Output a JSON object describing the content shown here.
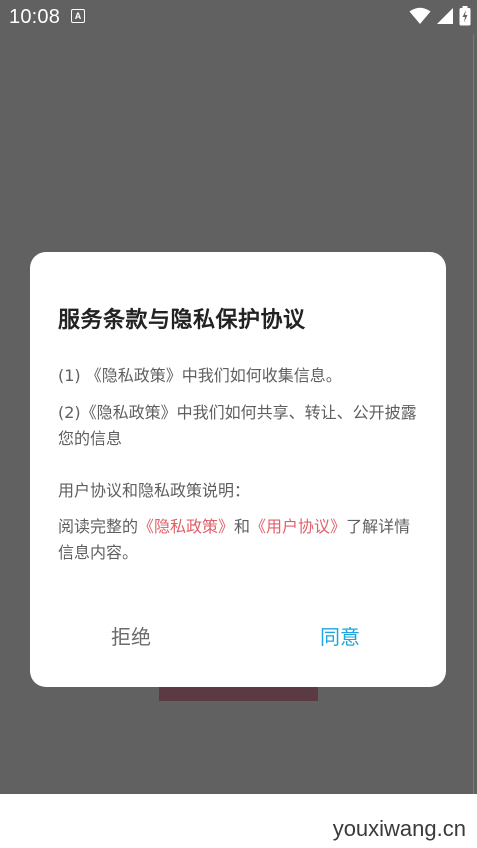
{
  "status_bar": {
    "time": "10:08",
    "notification_icon_letter": "A",
    "icons": [
      "wifi-icon",
      "signal-icon",
      "battery-charging-icon"
    ]
  },
  "dialog": {
    "title": "服务条款与隐私保护协议",
    "p1": "(1) 《隐私政策》中我们如何收集信息。",
    "p2": "(2)《隐私政策》中我们如何共享、转让、公开披露您的信息",
    "p3": "用户协议和隐私政策说明：",
    "p4_before": "阅读完整的",
    "p4_link1": "《隐私政策》",
    "p4_middle": "和",
    "p4_link2": "《用户协议》",
    "p4_after": "了解详情信息内容。",
    "refuse_label": "拒绝",
    "agree_label": "同意"
  },
  "watermark": "youxiwang.cn",
  "colors": {
    "overlay": "#616161",
    "agree": "#1ea4e0",
    "link": "#e0606a",
    "background_button": "#5c3a43"
  }
}
